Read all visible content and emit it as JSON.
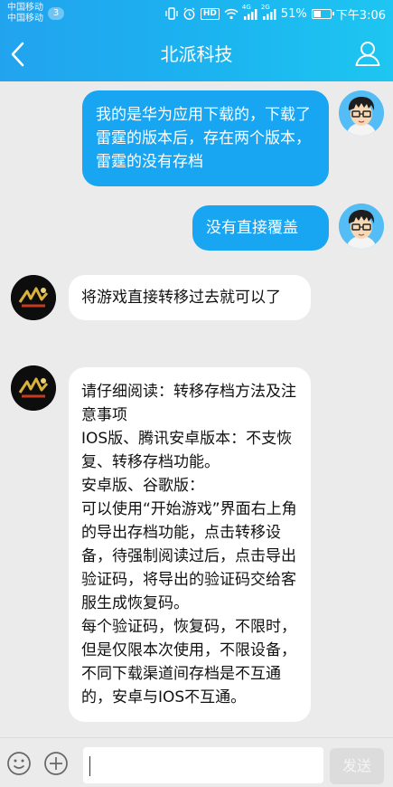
{
  "status_bar": {
    "carrier_1": "中国移动",
    "carrier_2": "中国移动",
    "sim_badge": "3",
    "hd": "HD",
    "network_1": "4G",
    "network_2": "2G",
    "battery": "51%",
    "battery_level": 0.51,
    "time": "下午3:06"
  },
  "nav": {
    "title": "北派科技",
    "back_icon": "chevron-left-icon",
    "profile_icon": "person-icon"
  },
  "messages": [
    {
      "sender": "me",
      "text": "我的是华为应用下载的，下载了雷霆的版本后，存在两个版本，雷霆的没有存档"
    },
    {
      "sender": "me",
      "text": "没有直接覆盖"
    },
    {
      "sender": "service",
      "text": "将游戏直接转移过去就可以了"
    },
    {
      "sender": "service",
      "text": "请仔细阅读：转移存档方法及注意事项\nIOS版、腾讯安卓版本：不支恢复、转移存档功能。\n安卓版、谷歌版：\n可以使用“开始游戏”界面右上角的导出存档功能，点击转移设备，待强制阅读过后，点击导出验证码，将导出的验证码交给客服生成恢复码。\n每个验证码，恢复码，不限时，但是仅限本次使用，不限设备，不同下载渠道间存档是不互通的，安卓与IOS不互通。"
    }
  ],
  "input_bar": {
    "emoji_icon": "smiley-icon",
    "plus_icon": "plus-icon",
    "input_value": "",
    "send_label": "发送"
  },
  "colors": {
    "header_start": "#22a3ee",
    "header_end": "#1ec6f1",
    "outgoing_bubble": "#18a6f3",
    "incoming_bubble": "#ffffff",
    "background": "#ebebeb"
  }
}
